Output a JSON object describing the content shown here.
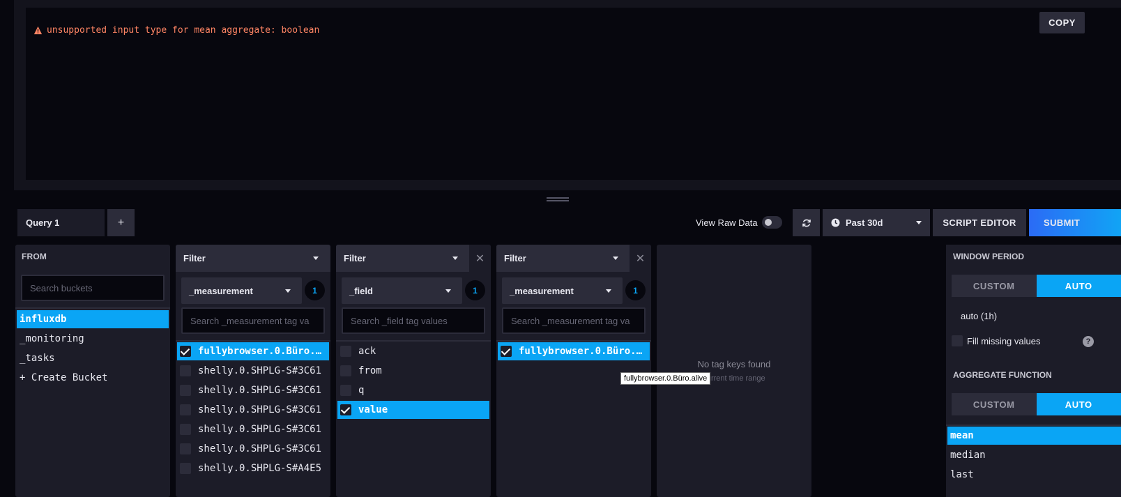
{
  "result": {
    "error_message": "unsupported input type for mean aggregate: boolean",
    "copy_label": "COPY"
  },
  "toolbar": {
    "query_tab": "Query 1",
    "add_query": "+",
    "view_raw_label": "View Raw Data",
    "time_range": "Past 30d",
    "script_editor": "SCRIPT EDITOR",
    "submit": "SUBMIT"
  },
  "from": {
    "title": "FROM",
    "search_placeholder": "Search buckets",
    "buckets": [
      "influxdb",
      "_monitoring",
      "_tasks",
      "+ Create Bucket"
    ]
  },
  "filters": [
    {
      "title": "Filter",
      "key": "_measurement",
      "count": "1",
      "search_placeholder": "Search _measurement tag va",
      "values": [
        {
          "label": "fullybrowser.0.Büro.alive",
          "checked": true
        },
        {
          "label": "shelly.0.SHPLG-S#3C61",
          "checked": false
        },
        {
          "label": "shelly.0.SHPLG-S#3C61",
          "checked": false
        },
        {
          "label": "shelly.0.SHPLG-S#3C61",
          "checked": false
        },
        {
          "label": "shelly.0.SHPLG-S#3C61",
          "checked": false
        },
        {
          "label": "shelly.0.SHPLG-S#3C61",
          "checked": false
        },
        {
          "label": "shelly.0.SHPLG-S#A4E5",
          "checked": false
        }
      ]
    },
    {
      "title": "Filter",
      "key": "_field",
      "count": "1",
      "search_placeholder": "Search _field tag values",
      "values": [
        {
          "label": "ack",
          "checked": false
        },
        {
          "label": "from",
          "checked": false
        },
        {
          "label": "q",
          "checked": false
        },
        {
          "label": "value",
          "checked": true
        }
      ]
    },
    {
      "title": "Filter",
      "key": "_measurement",
      "count": "1",
      "search_placeholder": "Search _measurement tag va",
      "values": [
        {
          "label": "fullybrowser.0.Büro.alive",
          "checked": true
        }
      ]
    }
  ],
  "empty_panel": {
    "message": "No tag keys found",
    "sub": "current time range"
  },
  "tooltip": "fullybrowser.0.Büro.alive",
  "window_period": {
    "title": "WINDOW PERIOD",
    "custom": "CUSTOM",
    "auto": "AUTO",
    "value": "auto (1h)",
    "fill_missing": "Fill missing values",
    "help": "?"
  },
  "aggregate": {
    "title": "AGGREGATE FUNCTION",
    "custom": "CUSTOM",
    "auto": "AUTO",
    "functions": [
      "mean",
      "median",
      "last"
    ]
  },
  "colors": {
    "accent": "#0aa5f5",
    "error": "#ff8564",
    "panel": "#1c1c28",
    "background": "#07070e"
  }
}
